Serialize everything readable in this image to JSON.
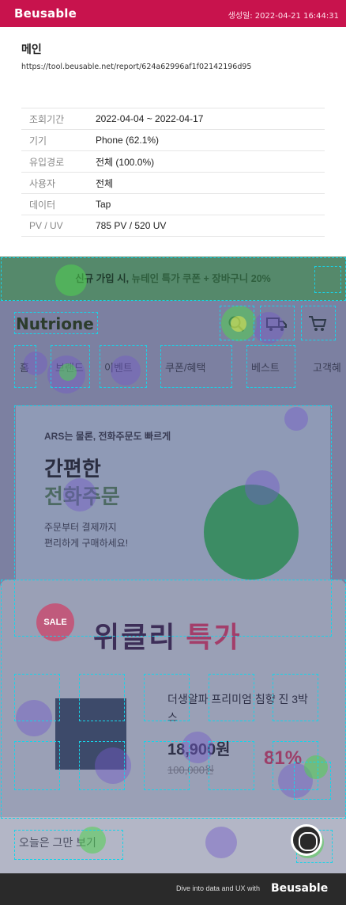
{
  "header": {
    "brand": "Beusable",
    "created": "생성일: 2022-04-21 16:44:31"
  },
  "report": {
    "title": "메인",
    "url": "https://tool.beusable.net/report/624a62996af1f02142196d95"
  },
  "info": [
    {
      "label": "조회기간",
      "value": "2022-04-04 ~ 2022-04-17"
    },
    {
      "label": "기기",
      "value": "Phone (62.1%)"
    },
    {
      "label": "유입경로",
      "value": "전체 (100.0%)"
    },
    {
      "label": "사용자",
      "value": "전체"
    },
    {
      "label": "데이터",
      "value": "Tap"
    },
    {
      "label": "PV / UV",
      "value": "785 PV / 520 UV"
    }
  ],
  "screenshot": {
    "banner_a": "신규 가입 시, ",
    "banner_b": "뉴테인 특가 쿠폰 + 장바구니 20%",
    "brand": "Nutrione",
    "nav": [
      "홈",
      "브랜드",
      "이벤트",
      "쿠폰/혜택",
      "베스트",
      "고객혜"
    ],
    "hero": {
      "line1": "ARS는 물론, 전화주문도 빠르게",
      "line2": "간편한",
      "line3": "전화주문",
      "line4": "주문부터 결제까지",
      "line5": "편리하게 구매하세요!"
    },
    "weekly": {
      "sale": "SALE",
      "title_a": "위클리 ",
      "title_b": "특가",
      "product_name": "더생알파 프리미엄 침향 진 3박스",
      "price": "18,900원",
      "old_price": "100,000원",
      "discount": "81%"
    },
    "dont_show": "오늘은 그만 보기"
  },
  "footer": {
    "tagline": "Dive into data and UX with",
    "brand": "Beusable"
  },
  "colors": {
    "brand": "#c8134d",
    "footer": "#2a2a2a"
  }
}
